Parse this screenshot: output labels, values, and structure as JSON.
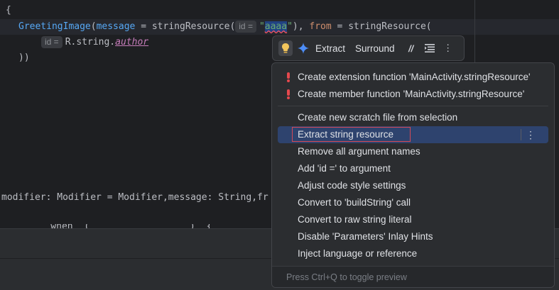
{
  "editor": {
    "line_brace": "{",
    "line2": {
      "fn": "GreetingImage",
      "open": "(",
      "param1": "message",
      "eq1": " = ",
      "call1": "stringResource",
      "open2": "(",
      "hint1": "id =",
      "str_open": "\"",
      "str_val": "aaaa",
      "str_close": "\"",
      "close_comma": "), ",
      "param2": "from",
      "eq2": " = ",
      "call2": "stringResource",
      "open3": "("
    },
    "line3": {
      "hint2": "id =",
      "prefix": "R.string.",
      "prop": "author"
    },
    "line4": "))",
    "line5": "modifier: Modifier = Modifier,message: String,fr",
    "peek": "    when  (                  )  {  "
  },
  "toolbar": {
    "bulb_icon": "lightbulb-icon",
    "ai_icon": "sparkle-icon",
    "extract": "Extract",
    "surround": "Surround",
    "comment_icon": "comment-slashes-icon",
    "format_icon": "format-lines-icon",
    "more_icon": "vertical-ellipsis-icon"
  },
  "menu": {
    "error_items": [
      "Create extension function 'MainActivity.stringResource'",
      "Create member function 'MainActivity.stringResource'"
    ],
    "items": [
      "Create new scratch file from selection",
      "Extract string resource",
      "Remove all argument names",
      "Add 'id =' to argument",
      "Adjust code style settings",
      "Convert to 'buildString' call",
      "Convert to raw string literal",
      "Disable 'Parameters' Inlay Hints",
      "Inject language or reference"
    ],
    "selected_index": 1,
    "footer": "Press Ctrl+Q to toggle preview",
    "colors": {
      "selected_bg": "#2e436e",
      "error_red": "#e5484d",
      "highlight_border": "#d44a56"
    }
  }
}
